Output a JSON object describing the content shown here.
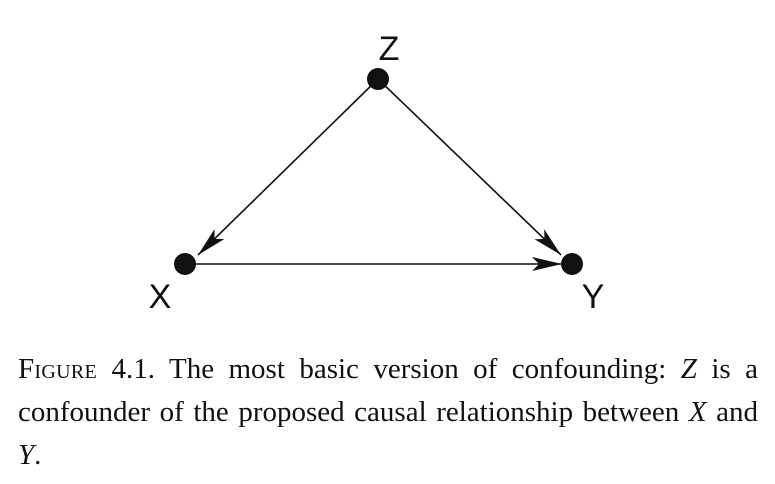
{
  "diagram": {
    "nodes": [
      {
        "id": "Z",
        "label": "Z"
      },
      {
        "id": "X",
        "label": "X"
      },
      {
        "id": "Y",
        "label": "Y"
      }
    ],
    "edges": [
      {
        "from": "Z",
        "to": "X"
      },
      {
        "from": "Z",
        "to": "Y"
      },
      {
        "from": "X",
        "to": "Y"
      }
    ],
    "colors": {
      "ink": "#111111",
      "background": "#ffffff"
    }
  },
  "caption": {
    "figure_label": "Figure",
    "figure_number": "4.1.",
    "text_part1": "The most basic version of confounding: ",
    "var_z": "Z",
    "text_part2": " is a confounder of the proposed causal relationship between ",
    "var_x": "X",
    "text_part3": " and ",
    "var_y": "Y",
    "text_part4": "."
  }
}
